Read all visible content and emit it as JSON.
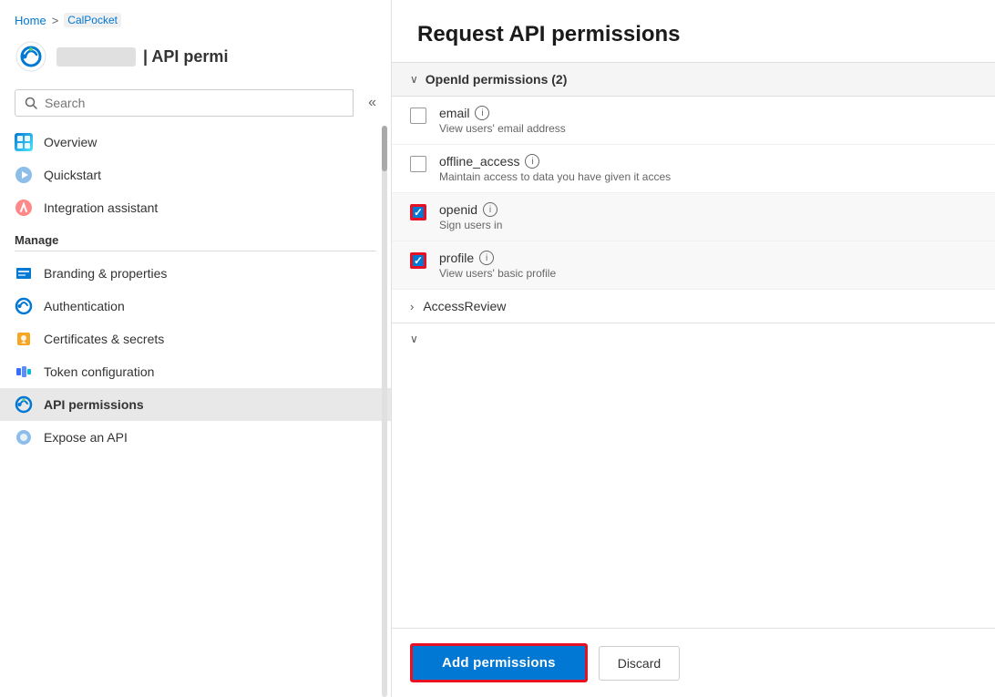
{
  "breadcrumb": {
    "home": "Home",
    "separator": ">",
    "current": "CalPocket"
  },
  "app": {
    "name_blur": "CalPocket",
    "title_prefix": "| API permi"
  },
  "search": {
    "placeholder": "Search",
    "label": "Search"
  },
  "collapse_btn": "«",
  "nav": {
    "items": [
      {
        "id": "overview",
        "label": "Overview",
        "icon": "overview"
      },
      {
        "id": "quickstart",
        "label": "Quickstart",
        "icon": "quickstart"
      },
      {
        "id": "integration",
        "label": "Integration assistant",
        "icon": "integration"
      }
    ],
    "manage_label": "Manage",
    "manage_items": [
      {
        "id": "branding",
        "label": "Branding & properties",
        "icon": "branding"
      },
      {
        "id": "auth",
        "label": "Authentication",
        "icon": "auth"
      },
      {
        "id": "certs",
        "label": "Certificates & secrets",
        "icon": "certs"
      },
      {
        "id": "token",
        "label": "Token configuration",
        "icon": "token"
      },
      {
        "id": "api",
        "label": "API permissions",
        "icon": "api",
        "active": true
      },
      {
        "id": "expose",
        "label": "Expose an API",
        "icon": "expose"
      }
    ]
  },
  "panel": {
    "title": "Request API permissions",
    "section_openid": {
      "label": "OpenId permissions (2)",
      "chevron": "∨"
    },
    "permissions": [
      {
        "id": "email",
        "name": "email",
        "desc": "View users' email address",
        "checked": false,
        "highlighted": false
      },
      {
        "id": "offline_access",
        "name": "offline_access",
        "desc": "Maintain access to data you have given it acces",
        "checked": false,
        "highlighted": false
      },
      {
        "id": "openid",
        "name": "openid",
        "desc": "Sign users in",
        "checked": true,
        "highlighted": true
      },
      {
        "id": "profile",
        "name": "profile",
        "desc": "View users' basic profile",
        "checked": true,
        "highlighted": true
      }
    ],
    "access_review": {
      "label": "AccessReview",
      "chevron": "›"
    },
    "collapsed_section_chevron": "∨",
    "buttons": {
      "add": "Add permissions",
      "discard": "Discard"
    }
  }
}
